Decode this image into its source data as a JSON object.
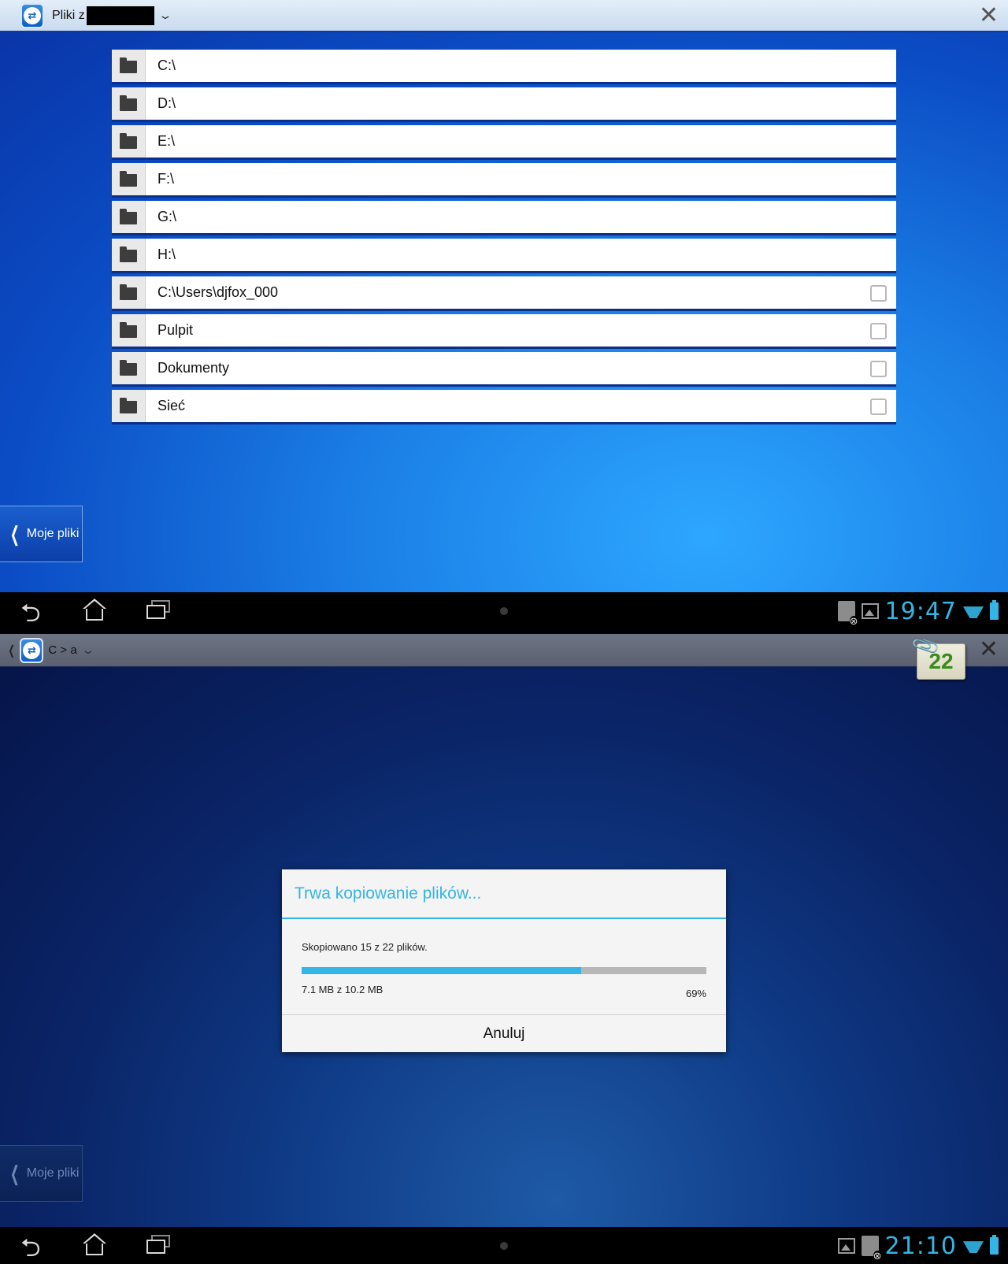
{
  "screen1": {
    "title_prefix": "Pliki z",
    "rows": [
      {
        "label": "C:\\",
        "checkbox": false
      },
      {
        "label": "D:\\",
        "checkbox": false
      },
      {
        "label": "E:\\",
        "checkbox": false
      },
      {
        "label": "F:\\",
        "checkbox": false
      },
      {
        "label": "G:\\",
        "checkbox": false
      },
      {
        "label": "H:\\",
        "checkbox": false
      },
      {
        "label": "C:\\Users\\djfox_000",
        "checkbox": true
      },
      {
        "label": "Pulpit",
        "checkbox": true
      },
      {
        "label": "Dokumenty",
        "checkbox": true
      },
      {
        "label": "Sieć",
        "checkbox": true
      }
    ],
    "my_files_label": "Moje pliki",
    "clock": "19:47"
  },
  "screen2": {
    "breadcrumb": "C > a",
    "transfer_count": "22",
    "dialog": {
      "title": "Trwa kopiowanie plików...",
      "message": "Skopiowano 15 z 22 plików.",
      "size_text": "7.1 MB z 10.2 MB",
      "percent_text": "69%",
      "progress": 0.69,
      "cancel_label": "Anuluj"
    },
    "my_files_label": "Moje pliki",
    "clock": "21:10"
  },
  "colors": {
    "accent": "#33b5e5",
    "desktop_blue": "#1b7fe6",
    "badge_green": "#3a8a1c"
  },
  "icons": [
    "teamviewer-logo-icon",
    "chevron-down-icon",
    "close-icon",
    "folder-icon",
    "back-icon",
    "home-icon",
    "recent-apps-icon",
    "sd-card-icon",
    "image-icon",
    "wifi-icon",
    "battery-icon",
    "paperclip-icon"
  ]
}
